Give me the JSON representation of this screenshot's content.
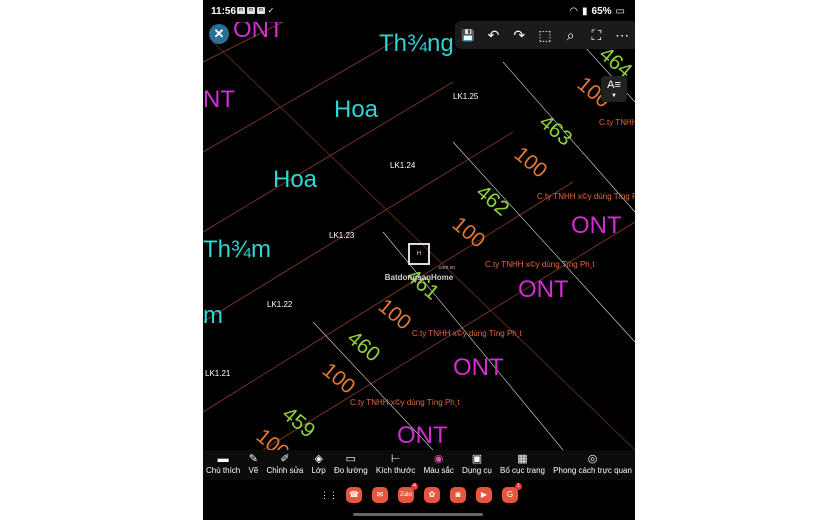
{
  "status_bar": {
    "time": "11:56",
    "battery": "65%",
    "notifications": [
      "m",
      "m",
      "m",
      "✓"
    ]
  },
  "map": {
    "zones_cyan": [
      {
        "text": "Th¾ng"
      },
      {
        "text": "Hoa"
      },
      {
        "text": "Hoa"
      },
      {
        "text": "Th¾m"
      },
      {
        "text": "m"
      }
    ],
    "zones_magenta": [
      {
        "text": "ONT"
      },
      {
        "text": "NT"
      },
      {
        "text": "ONT"
      },
      {
        "text": "ONT"
      },
      {
        "text": "ONT"
      },
      {
        "text": "ONT"
      }
    ],
    "parcel_numbers": [
      "464",
      "463",
      "462",
      "461",
      "460",
      "459"
    ],
    "area_values": [
      "100",
      "100",
      "100",
      "100",
      "100",
      "100"
    ],
    "lot_labels": [
      "LK1.25",
      "LK1.24",
      "LK1.23",
      "LK1.22",
      "LK1.21"
    ],
    "company_labels": [
      "C.ty TNHH",
      "C.ty TNHH x©y dùng Tïng Ph",
      "C.ty TNHH x©y dùng Tïng Ph¸t",
      "C.ty TNHH x©y dùng Tïng Ph¸t",
      "C.ty TNHH x©y dùng Tïng Ph¸t"
    ],
    "watermark": {
      "name": "BatdongsanHome",
      "sub": ".com.vn"
    }
  },
  "top_toolbar": {
    "buttons": [
      {
        "name": "save-icon",
        "glyph": "💾"
      },
      {
        "name": "undo-icon",
        "glyph": "↶"
      },
      {
        "name": "redo-icon",
        "glyph": "↷"
      },
      {
        "name": "crop-icon",
        "glyph": "⬚"
      },
      {
        "name": "zoom-icon",
        "glyph": "⌕"
      },
      {
        "name": "fullscreen-icon",
        "glyph": "⛶"
      },
      {
        "name": "more-icon",
        "glyph": "⋯"
      }
    ]
  },
  "text_button": {
    "label": "A≡"
  },
  "bottom_toolbar": {
    "tools": [
      {
        "label": "Chú thích",
        "icon": "comment-icon",
        "glyph": "▬"
      },
      {
        "label": "Vẽ",
        "icon": "pen-icon",
        "glyph": "✎"
      },
      {
        "label": "Chỉnh sửa",
        "icon": "edit-icon",
        "glyph": "✐"
      },
      {
        "label": "Lớp",
        "icon": "layers-icon",
        "glyph": "◈"
      },
      {
        "label": "Đo lường",
        "icon": "ruler-icon",
        "glyph": "▭"
      },
      {
        "label": "Kích thước",
        "icon": "dimension-icon",
        "glyph": "⊢"
      },
      {
        "label": "Màu sắc",
        "icon": "color-wheel-icon",
        "glyph": "◉"
      },
      {
        "label": "Dụng cụ",
        "icon": "toolbox-icon",
        "glyph": "▣"
      },
      {
        "label": "Bố cục trang",
        "icon": "layout-icon",
        "glyph": "▦"
      },
      {
        "label": "Phong cách trực quan",
        "icon": "visual-style-icon",
        "glyph": "◎"
      }
    ]
  },
  "dock": {
    "apps": [
      {
        "name": "app-drawer-icon",
        "glyph": "⋮⋮",
        "color": "#000000"
      },
      {
        "name": "phone-app-icon",
        "glyph": "☎",
        "color": "#e8553e"
      },
      {
        "name": "messages-app-icon",
        "glyph": "✉",
        "color": "#e8553e"
      },
      {
        "name": "zalo-app-icon",
        "glyph": "Zalo",
        "color": "#e8553e",
        "badge": "4"
      },
      {
        "name": "flower-app-icon",
        "glyph": "✿",
        "color": "#e8553e"
      },
      {
        "name": "camera-app-icon",
        "glyph": "◙",
        "color": "#e8553e"
      },
      {
        "name": "youtube-app-icon",
        "glyph": "▶",
        "color": "#e8553e"
      },
      {
        "name": "google-app-icon",
        "glyph": "G",
        "color": "#e8553e",
        "badge": "1"
      }
    ]
  }
}
